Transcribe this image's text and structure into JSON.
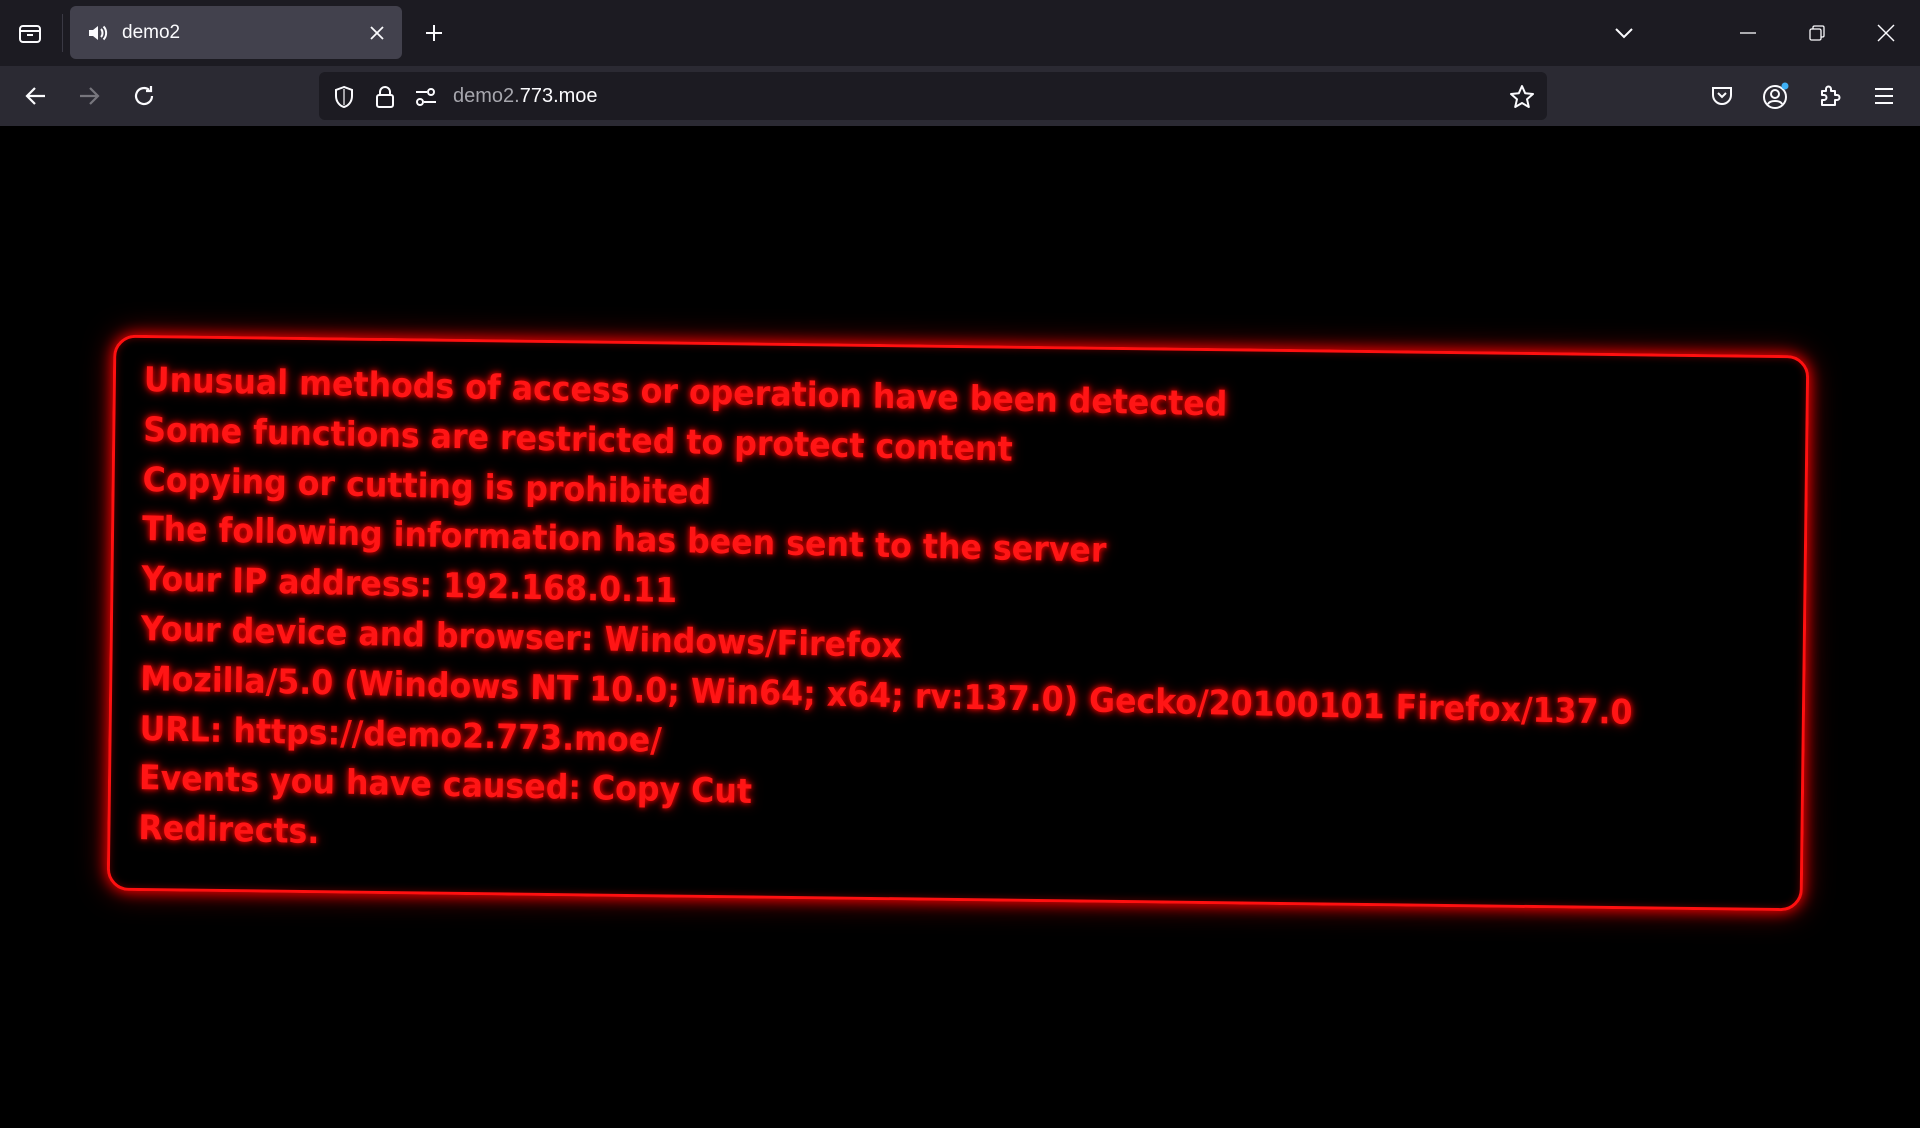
{
  "tab": {
    "title": "demo2"
  },
  "urlbar": {
    "url_prefix": "demo2.",
    "url_domain": "773.moe"
  },
  "colors": {
    "accent": "#ff1010",
    "tabstrip_bg": "#1c1b22",
    "navbar_bg": "#2b2a33",
    "tab_bg": "#42414d"
  },
  "warning": {
    "lines": [
      "Unusual methods of access or operation have been detected",
      "Some functions are restricted to protect content",
      "Copying or cutting is prohibited",
      "The following information has been sent to the server",
      "Your IP address: 192.168.0.11",
      "Your device and browser: Windows/Firefox",
      "Mozilla/5.0 (Windows NT 10.0; Win64; x64; rv:137.0) Gecko/20100101 Firefox/137.0",
      "URL: https://demo2.773.moe/",
      "Events you have caused: Copy Cut",
      "Redirects."
    ]
  },
  "icons": {
    "list_all_tabs": "list-all-tabs-icon",
    "speaker": "speaker-icon",
    "close": "close-icon",
    "new_tab": "plus-icon",
    "tabs_menu": "chevron-down-icon",
    "minimize": "minimize-icon",
    "restore": "restore-icon",
    "window_close": "window-close-icon",
    "back": "back-arrow-icon",
    "forward": "forward-arrow-icon",
    "reload": "reload-icon",
    "shield": "shield-icon",
    "lock": "lock-icon",
    "permissions": "permissions-icon",
    "bookmark": "star-icon",
    "pocket": "pocket-icon",
    "account": "account-icon",
    "extensions": "extensions-icon",
    "menu": "hamburger-menu-icon"
  }
}
